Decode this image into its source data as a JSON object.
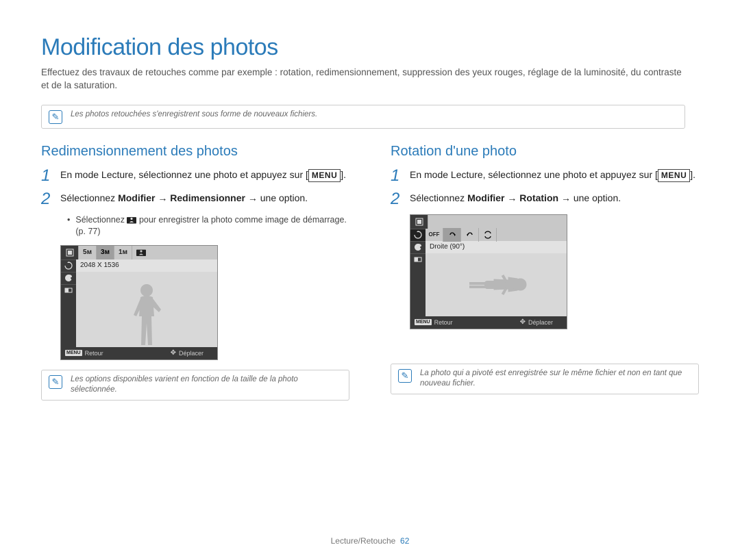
{
  "title": "Modification des photos",
  "intro": "Effectuez des travaux de retouches comme par exemple : rotation, redimensionnement, suppression des yeux rouges, réglage de la luminosité, du contraste et de la saturation.",
  "top_note": "Les photos retouchées s'enregistrent sous forme de nouveaux fichiers.",
  "left": {
    "heading": "Redimensionnement des photos",
    "step1_a": "En mode Lecture, sélectionnez une photo et appuyez sur [",
    "step1_menu": "MENU",
    "step1_b": "].",
    "step2_a": "Sélectionnez ",
    "step2_bold": "Modifier → Redimensionner",
    "step2_b": " → une option.",
    "bullet_a": "Sélectionnez ",
    "bullet_b": " pour enregistrer la photo comme image de démarrage. (p. 77)",
    "screen": {
      "opt1": "5ᴍ",
      "opt2": "3ᴍ",
      "opt3": "1ᴍ",
      "info": "2048 X 1536",
      "footer_back_label": "MENU",
      "footer_back": "Retour",
      "footer_move": "Déplacer"
    },
    "note": "Les options disponibles varient en fonction de la taille de la photo sélectionnée."
  },
  "right": {
    "heading": "Rotation d'une photo",
    "step1_a": "En mode Lecture, sélectionnez une photo et appuyez sur [",
    "step1_menu": "MENU",
    "step1_b": "].",
    "step2_a": "Sélectionnez ",
    "step2_bold": "Modifier → Rotation",
    "step2_b": " → une option.",
    "screen": {
      "off": "OFF",
      "info": "Droite (90°)",
      "footer_back_label": "MENU",
      "footer_back": "Retour",
      "footer_move": "Déplacer"
    },
    "note": "La photo qui a pivoté est enregistrée sur le même fichier et non en tant que nouveau fichier."
  },
  "footer": {
    "section": "Lecture/Retouche",
    "page": "62"
  }
}
